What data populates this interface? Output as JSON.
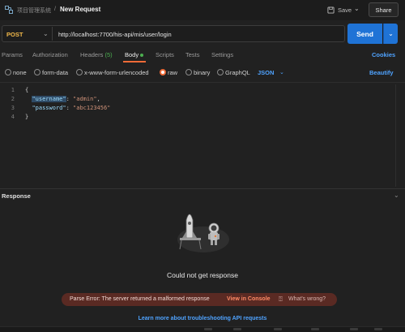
{
  "titlebar": {
    "workspace": "项目管理系统",
    "separator": "/",
    "request_name": "New Request",
    "save_label": "Save",
    "share_label": "Share"
  },
  "request": {
    "method": "POST",
    "url": "http://localhost:7700/his-api/mis/user/login",
    "send_label": "Send"
  },
  "tabs": [
    {
      "label": "Params"
    },
    {
      "label": "Authorization"
    },
    {
      "label": "Headers",
      "count": "(5)"
    },
    {
      "label": "Body"
    },
    {
      "label": "Scripts"
    },
    {
      "label": "Tests"
    },
    {
      "label": "Settings"
    }
  ],
  "cookies_label": "Cookies",
  "body_types": [
    "none",
    "form-data",
    "x-www-form-urlencoded",
    "raw",
    "binary",
    "GraphQL"
  ],
  "body_type_selected": "raw",
  "format": "JSON",
  "beautify_label": "Beautify",
  "editor": {
    "line_numbers": [
      "1",
      "2",
      "3",
      "4"
    ],
    "open_brace": "{",
    "close_brace": "}",
    "lines": [
      {
        "key": "\"username\"",
        "value": "\"admin\"",
        "trailing": ","
      },
      {
        "key": "\"password\"",
        "value": "\"abc123456\"",
        "trailing": ""
      }
    ]
  },
  "response": {
    "title": "Response",
    "message": "Could not get response",
    "error_text": "Parse Error: The server returned a malformed response",
    "view_console": "View in Console",
    "whats_wrong": "What's wrong?",
    "learn_more": "Learn more about troubleshooting API requests"
  },
  "colors": {
    "accent_send": "#1f73d6",
    "tab_active_underline": "#ef6a37",
    "method_post": "#f2b94a",
    "link": "#4fa3ff",
    "error_banner": "#5a2a23"
  },
  "icons": [
    "app-icon",
    "save-icon",
    "chevron-down-icon",
    "rocket-illustration",
    "astronaut-illustration",
    "help-icon"
  ]
}
